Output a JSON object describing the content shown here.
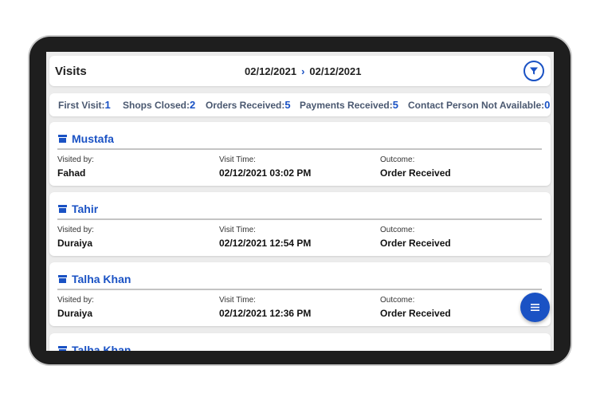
{
  "header": {
    "title": "Visits",
    "date_from": "02/12/2021",
    "date_to": "02/12/2021"
  },
  "stats": [
    {
      "label": "First Visit:",
      "value": "1"
    },
    {
      "label": "Shops Closed:",
      "value": "2"
    },
    {
      "label": "Orders Received:",
      "value": "5"
    },
    {
      "label": "Payments Received:",
      "value": "5"
    },
    {
      "label": "Contact Person Not Available:",
      "value": "0"
    }
  ],
  "field_labels": {
    "visited_by": "Visited by:",
    "visit_time": "Visit Time:",
    "outcome": "Outcome:"
  },
  "visits": [
    {
      "shop": "Mustafa",
      "visited_by": "Fahad",
      "visit_time": "02/12/2021 03:02 PM",
      "outcome": "Order Received"
    },
    {
      "shop": "Tahir",
      "visited_by": "Duraiya",
      "visit_time": "02/12/2021 12:54 PM",
      "outcome": "Order Received"
    },
    {
      "shop": "Talha Khan",
      "visited_by": "Duraiya",
      "visit_time": "02/12/2021 12:36 PM",
      "outcome": "Order Received"
    },
    {
      "shop": "Talha Khan",
      "visited_by": "",
      "visit_time": "",
      "outcome": ""
    }
  ],
  "colors": {
    "accent": "#1a52c4",
    "background": "#ececec",
    "card": "#ffffff"
  },
  "icons": {
    "filter": "filter-icon",
    "shop": "store-icon",
    "menu": "menu-icon"
  }
}
